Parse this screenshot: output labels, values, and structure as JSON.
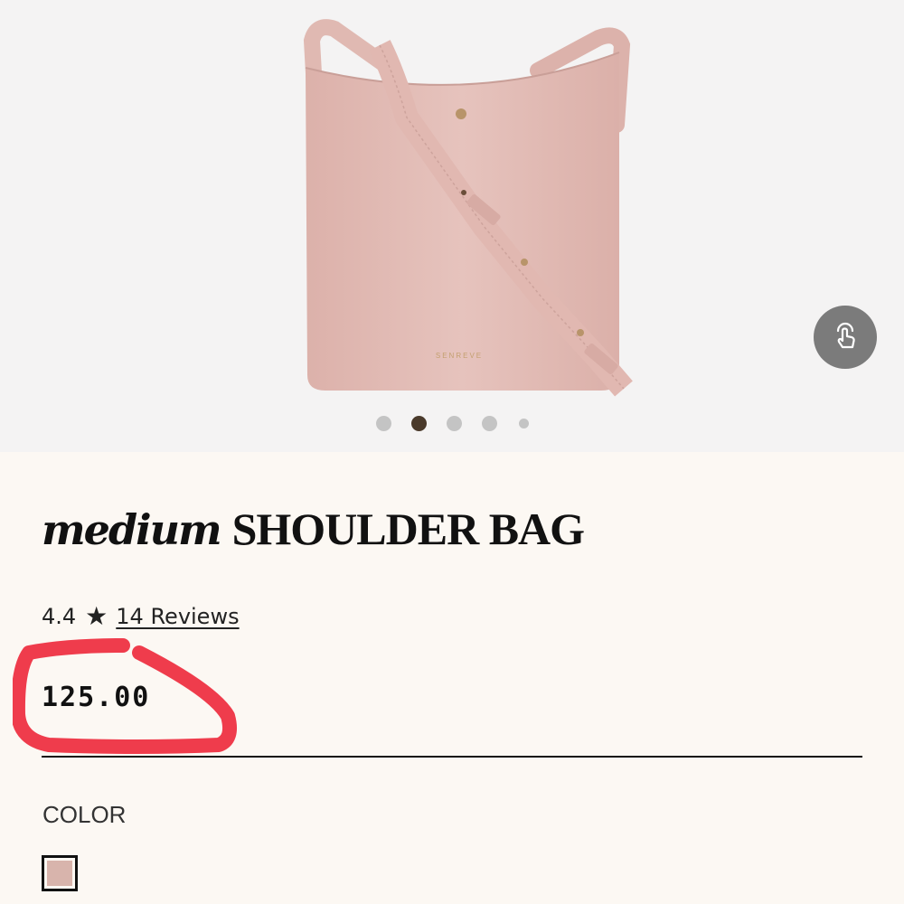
{
  "gallery": {
    "total_images": 5,
    "active_index": 1,
    "bag_brand_text": "SENREVE",
    "interact_icon": "hand-pointer-icon"
  },
  "product": {
    "title_script": "medium",
    "title_main": "SHOULDER BAG",
    "rating": "4.4",
    "rating_star": "★",
    "reviews_label": "14 Reviews",
    "price": "125.00"
  },
  "options": {
    "color_label": "COLOR",
    "swatches": [
      {
        "name": "blush",
        "hex": "#d8b4ac",
        "selected": true
      }
    ]
  },
  "colors": {
    "background": "#fcf8f3",
    "gallery_background": "#f4f3f3",
    "bag": "#e3bcb5",
    "annotation_circle": "#ee2b3e"
  }
}
